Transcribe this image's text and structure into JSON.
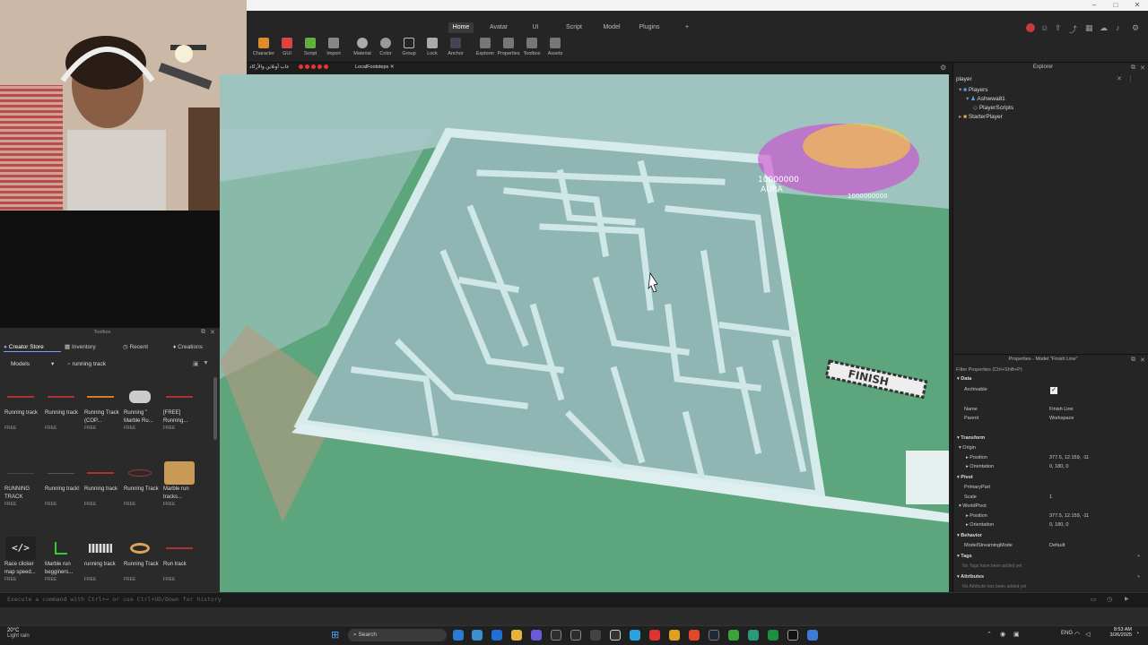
{
  "menu": {
    "items": [
      "Home",
      "Avatar",
      "UI",
      "Script",
      "Model",
      "Plugins",
      "+"
    ],
    "active": "Home"
  },
  "tools": [
    "Character",
    "GUI",
    "Script",
    "Import",
    "Material",
    "Color",
    "Group",
    "Lock",
    "Anchor",
    "Explorer",
    "Properties",
    "Toolbox",
    "Assets"
  ],
  "doc_tabs": {
    "tab1": "عاب أونلاين والأركاد",
    "tab2": "LocalFootsteps"
  },
  "viewport": {
    "aura_number": "10000000",
    "aura_label": "AURA",
    "aura_number2": "1000000000",
    "finish_sign": "FINISH"
  },
  "toolbox": {
    "title": "Toolbox",
    "tabs": [
      "Creator Store",
      "Inventory",
      "Recent",
      "Creations"
    ],
    "category": "Models",
    "search_value": "running track",
    "items": [
      {
        "title": "Running track",
        "price": "FREE"
      },
      {
        "title": "Running track",
        "price": "FREE"
      },
      {
        "title": "Running Track (COP...",
        "price": "FREE"
      },
      {
        "title": "Running \" Marble Ru...",
        "price": "FREE"
      },
      {
        "title": "[FREE] Running...",
        "price": "FREE"
      },
      {
        "title": "RUNNING TRACK",
        "price": "FREE"
      },
      {
        "title": "Running track!",
        "price": "FREE"
      },
      {
        "title": "Running track",
        "price": "FREE"
      },
      {
        "title": "Running Track",
        "price": "FREE"
      },
      {
        "title": "Marble run tracks...",
        "price": "FREE"
      },
      {
        "title": "Race clicker map speed...",
        "price": "FREE"
      },
      {
        "title": "Marble run begginers...",
        "price": "FREE"
      },
      {
        "title": "running track",
        "price": "FREE"
      },
      {
        "title": "Running Track",
        "price": "FREE"
      },
      {
        "title": "Run track",
        "price": "FREE"
      }
    ]
  },
  "explorer": {
    "title": "Explorer",
    "filter": "player",
    "tree": [
      "Players",
      "Ashwwa81",
      "PlayerScripts",
      "StarterPlayer"
    ]
  },
  "properties": {
    "title": "Properties - Model \"Finish Line\"",
    "filter_placeholder": "Filter Properties (Ctrl+Shift+P)",
    "sections": {
      "data": "Data",
      "transform": "Transform",
      "pivot": "Pivot",
      "behavior": "Behavior",
      "tags": "Tags",
      "attributes": "Attributes"
    },
    "rows": {
      "archivable": "Archivable",
      "name_label": "Name",
      "name_value": "Finish Line",
      "parent_label": "Parent",
      "parent_value": "Workspace",
      "origin": "Origin",
      "position_label": "Position",
      "position_value": "377.5, 12.159, -11",
      "orientation_label": "Orientation",
      "orientation_value": "0, 180, 0",
      "primarypart": "PrimaryPart",
      "scale_label": "Scale",
      "scale_value": "1",
      "worldpivot": "WorldPivot",
      "wp_position_value": "377.5, 12.159, -11",
      "wp_orientation_value": "0, 180, 0",
      "streaming_label": "ModelStreamingMode",
      "streaming_value": "Default",
      "tags_empty": "No Tags have been added yet",
      "attributes_empty": "No Attribute has been added yet"
    }
  },
  "command_bar": {
    "placeholder": "Execute a command with Ctrl+↩ or use Ctrl+UD/Down for history"
  },
  "taskbar": {
    "weather_temp": "20°C",
    "weather_desc": "Light rain",
    "search": "Search",
    "lang": "ENG",
    "time": "8:53 AM",
    "date": "3/26/2025"
  }
}
